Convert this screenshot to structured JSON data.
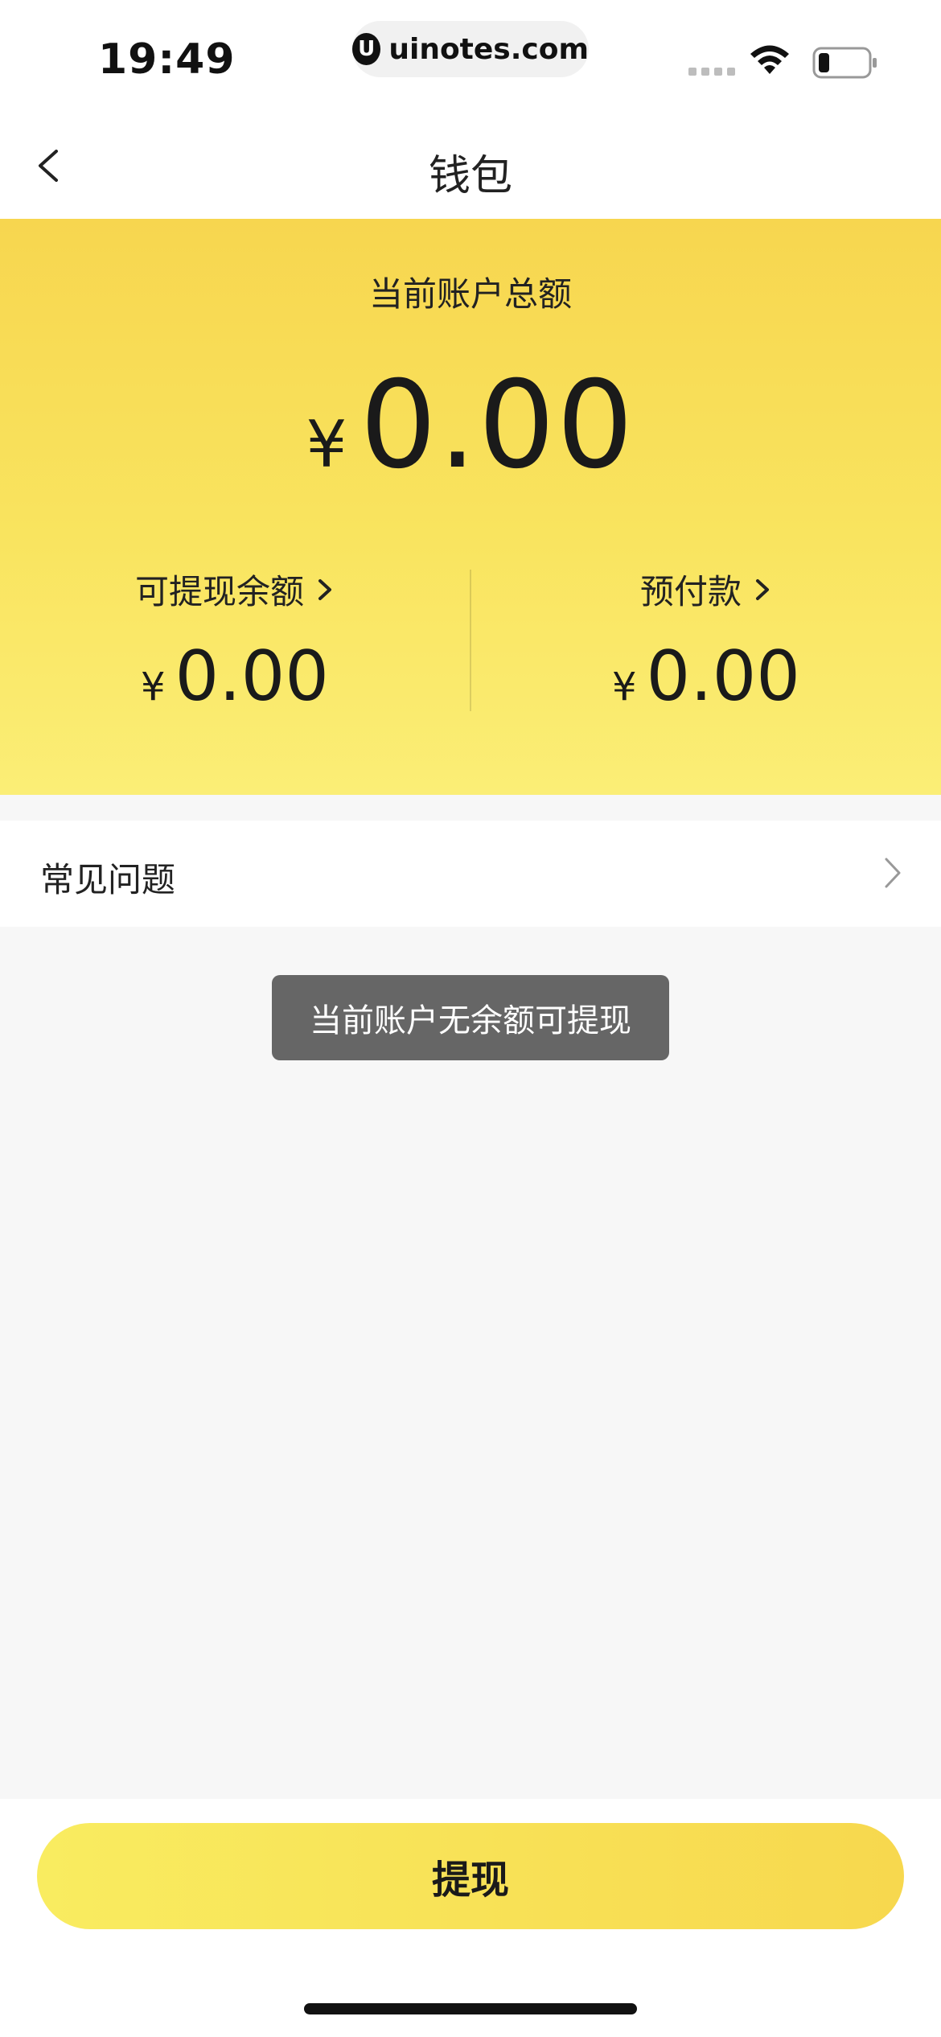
{
  "status_bar": {
    "time": "19:49",
    "url": "uinotes.com",
    "url_logo": "U",
    "icons": [
      "signal-icon",
      "wifi-icon",
      "battery-icon"
    ]
  },
  "nav": {
    "back_icon": "chevron-left-icon",
    "title": "钱包"
  },
  "wallet": {
    "total_label": "当前账户总额",
    "currency": "¥",
    "total_amount": "0.00",
    "withdrawable_label": "可提现余额",
    "withdrawable_amount": "0.00",
    "prepaid_label": "预付款",
    "prepaid_amount": "0.00"
  },
  "faq": {
    "label": "常见问题"
  },
  "toast": {
    "message": "当前账户无余额可提现"
  },
  "footer": {
    "withdraw_label": "提现"
  },
  "colors": {
    "card_top": "#f7d64f",
    "card_bottom": "#fbee76",
    "button_left": "#f9ec60",
    "button_right": "#f7d84e",
    "toast_bg": "#666666",
    "page_bg": "#f7f7f7"
  }
}
